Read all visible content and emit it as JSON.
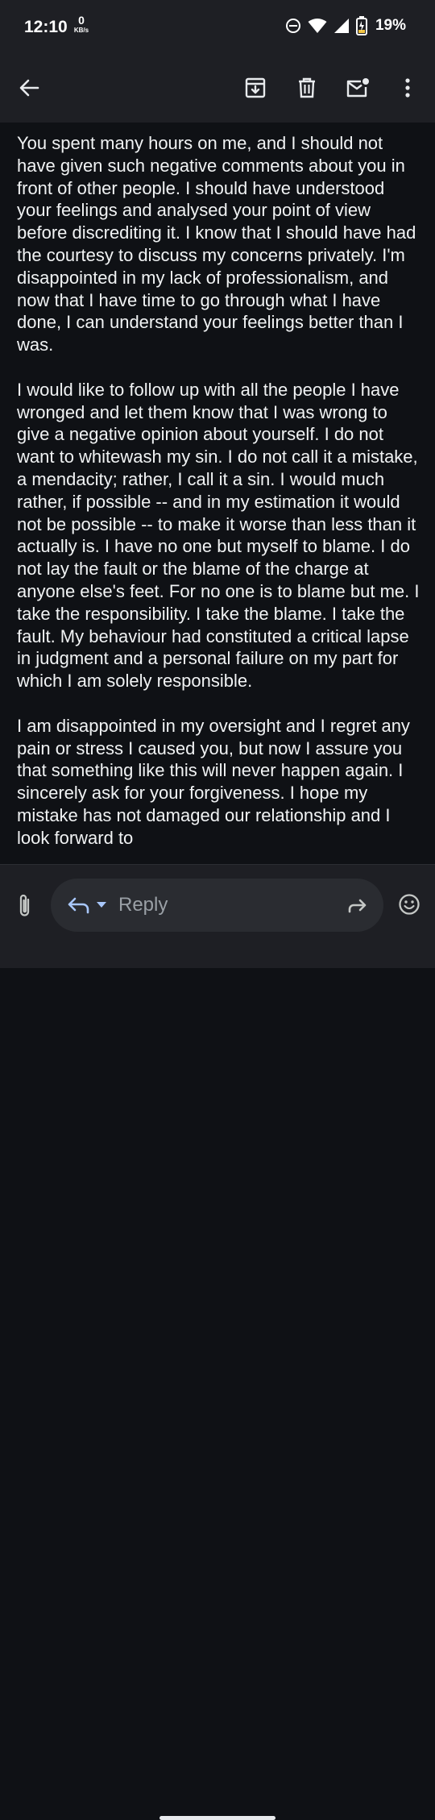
{
  "status_bar": {
    "time": "12:10",
    "net_speed_value": "0",
    "net_speed_unit": "KB/s",
    "battery_percent": "19%",
    "icons": [
      "dnd-icon",
      "wifi-icon",
      "signal-icon",
      "battery-charging-icon"
    ]
  },
  "toolbar": {
    "icons": [
      "back-arrow-icon",
      "archive-icon",
      "delete-icon",
      "mark-unread-icon",
      "more-vert-icon"
    ]
  },
  "email": {
    "paragraphs": [
      "You spent many hours on me, and I should not have given such negative comments about you in front of other people. I should have understood your feelings and analysed your point of view before discrediting it. I know that I should have had the courtesy to discuss my concerns privately. I'm disappointed in my lack of professionalism, and now that I have time to go through what I have done, I can understand your feelings better than I was.",
      "I would like to follow up with all the people I have wronged and let them know that I was wrong to give a negative opinion about yourself. I do not want to whitewash my sin. I do not call it a mistake, a mendacity; rather, I call it a sin. I would much rather, if possible -- and in my estimation it would not be possible -- to make it worse than less than it actually is. I have no one but myself to blame. I do not lay the fault or the blame of the charge at anyone else's feet. For no one is to blame but me. I take the responsibility. I take the blame. I take the fault. My behaviour had constituted a critical lapse in judgment and a personal failure on my part for which I am solely responsible.",
      "I am disappointed in my oversight and I regret any pain or stress I caused you, but now I assure you that something like this will never happen again. I sincerely ask for your forgiveness. I hope my mistake has not damaged our relationship and I look forward to"
    ]
  },
  "reply_bar": {
    "placeholder": "Reply",
    "icons": [
      "attachment-icon",
      "reply-icon",
      "chevron-down-icon",
      "forward-icon",
      "emoji-icon"
    ]
  },
  "colors": {
    "background": "#0f1115",
    "bar_background": "#1e1f24",
    "text": "#f1f3f4",
    "placeholder": "#9aa0a6"
  }
}
